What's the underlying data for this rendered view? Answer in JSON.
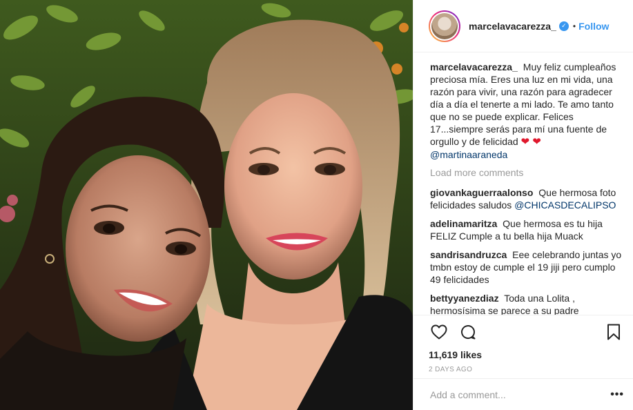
{
  "post": {
    "image_alt": "",
    "header": {
      "username": "marcelavacarezza_",
      "separator": "•",
      "follow_label": "Follow",
      "verified_icon": "verified-badge-icon"
    },
    "caption": {
      "username": "marcelavacarezza_",
      "text": "Muy feliz cumpleaños preciosa mía. Eres una luz en mi vida, una razón para vivir, una razón para agradecer día a día el tenerte a mi lado. Te amo tanto que no se puede explicar. Felices 17...siempre serás para mí una fuente de orgullo y de felicidad",
      "hearts": "❤ ❤",
      "mention": "@martinaaraneda"
    },
    "load_more_label": "Load more comments",
    "comments": [
      {
        "username": "giovankaguerraalonso",
        "text": "Que hermosa foto felicidades saludos",
        "mention": "@CHICASDECALIPSO"
      },
      {
        "username": "adelinamaritza",
        "text": "Que hermosa es tu hija FELIZ Cumple a tu bella hija Muack",
        "mention": ""
      },
      {
        "username": "sandrisandruzca",
        "text": "Eee celebrando juntas yo tmbn estoy de cumple el 19 jiji pero cumplo 49 felicidades",
        "mention": ""
      },
      {
        "username": "bettyyanezdiaz",
        "text": "Toda una Lolita , hermosísima se parece a su padre Felicitaciones",
        "mention": ""
      }
    ],
    "likes_label": "11,619 likes",
    "time_ago": "2 DAYS AGO",
    "add_comment_placeholder": "Add a comment...",
    "more_options": "•••",
    "icons": {
      "like": "heart-outline-icon",
      "comment": "speech-bubble-icon",
      "save": "bookmark-icon"
    },
    "colors": {
      "accent": "#3897f0",
      "text": "#262626",
      "muted": "#999999",
      "mention": "#003569",
      "heart": "#e0182d"
    }
  }
}
